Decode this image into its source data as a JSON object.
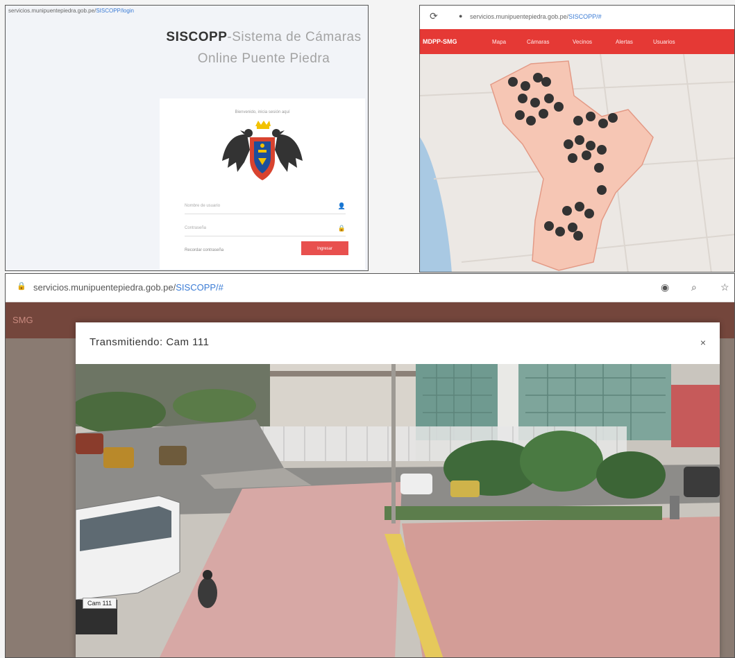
{
  "login": {
    "url_domain": "servicios.munipuentepiedra.gob.pe/",
    "url_path": "SISCOPP/login",
    "brand": "SISCOPP",
    "title_rest": "-Sistema de Cámaras Online Puente Piedra",
    "card_caption": "Bienvenido, inicia sesión aquí",
    "username_placeholder": "Nombre de usuario",
    "password_placeholder": "Contraseña",
    "remember_label": "Recordar contraseña",
    "submit_label": "Ingresar",
    "user_icon": "user-icon",
    "lock_icon": "lock-icon"
  },
  "map": {
    "url_domain": "servicios.munipuentepiedra.gob.pe/",
    "url_path": "SISCOPP/#",
    "brand": "MDPP-SMG",
    "nav": [
      "Mapa",
      "Cámaras",
      "Vecinos",
      "Alertas",
      "Usuarios"
    ],
    "accent": "#e53935"
  },
  "camera": {
    "url_domain": "servicios.munipuentepiedra.gob.pe/",
    "url_path": "SISCOPP/#",
    "bg_brand": "SMG",
    "modal_title": "Transmitiendo: Cam 111",
    "close_label": "×",
    "badge": "Cam 111",
    "icons": [
      "location-icon",
      "search-icon",
      "star-icon"
    ]
  }
}
